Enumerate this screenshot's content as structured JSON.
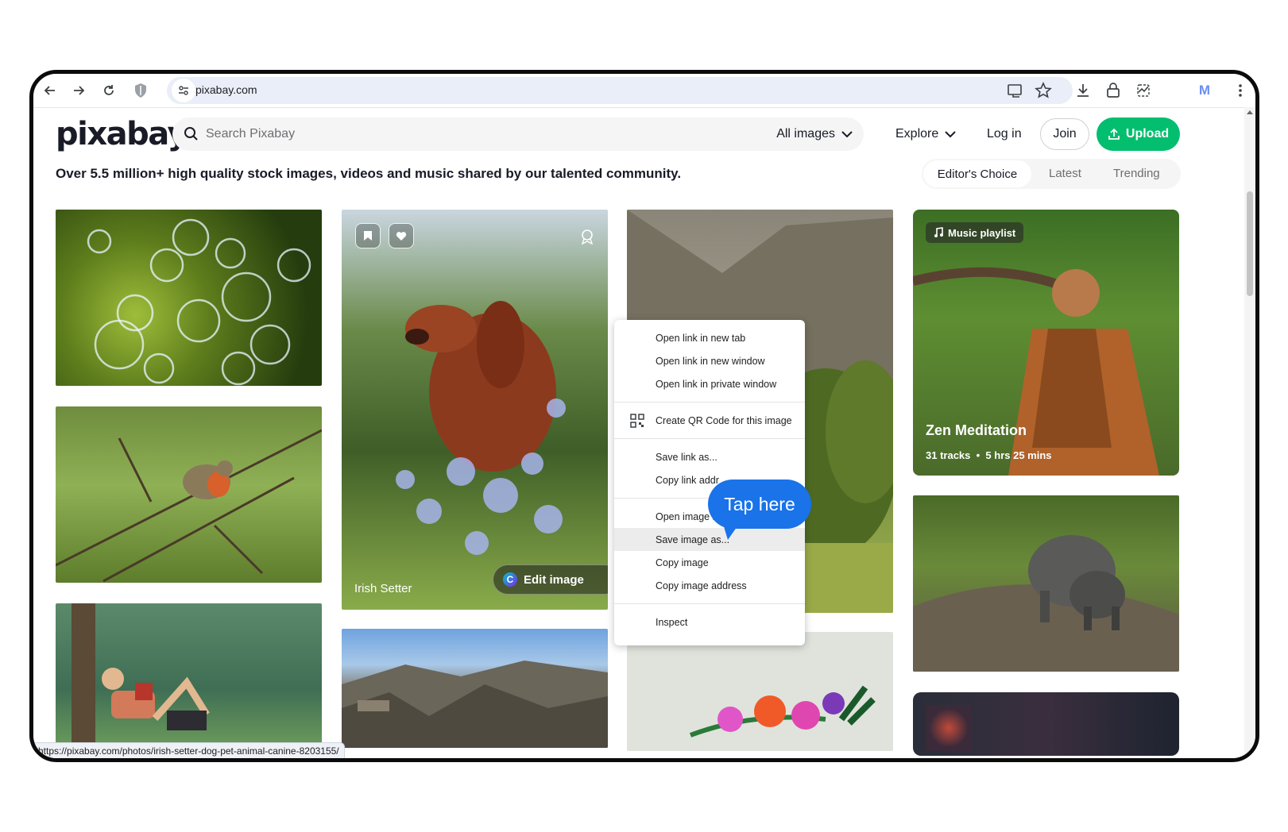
{
  "browser": {
    "url": "pixabay.com",
    "profile_initial": "M",
    "status_url": "https://pixabay.com/photos/irish-setter-dog-pet-animal-canine-8203155/"
  },
  "header": {
    "logo": "pixabay",
    "search_placeholder": "Search Pixabay",
    "filter_label": "All images",
    "explore_label": "Explore",
    "login_label": "Log in",
    "join_label": "Join",
    "upload_label": "Upload"
  },
  "tagline": "Over 5.5 million+ high quality stock images, videos and music shared by our talented community.",
  "sort": {
    "options": [
      "Editor's Choice",
      "Latest",
      "Trending"
    ],
    "active": "Editor's Choice"
  },
  "tiles": {
    "irish_setter_caption": "Irish Setter",
    "edit_image_label": "Edit image",
    "music_badge": "Music playlist",
    "zen_title": "Zen Meditation",
    "zen_tracks": "31 tracks",
    "zen_duration": "5 hrs 25 mins"
  },
  "context_menu": {
    "items": [
      "Open link in new tab",
      "Open link in new window",
      "Open link in private window",
      "Create QR Code for this image",
      "Save link as...",
      "Copy link address",
      "Open image in new tab",
      "Save image as...",
      "Copy image",
      "Copy image address",
      "Inspect"
    ],
    "display": {
      "copy_link_partial": "Copy link addr",
      "open_image_partial": "Open image in"
    },
    "highlighted": "Save image as..."
  },
  "callout": "Tap here",
  "colors": {
    "accent_green": "#02be6e",
    "callout_blue": "#1a73e8"
  }
}
